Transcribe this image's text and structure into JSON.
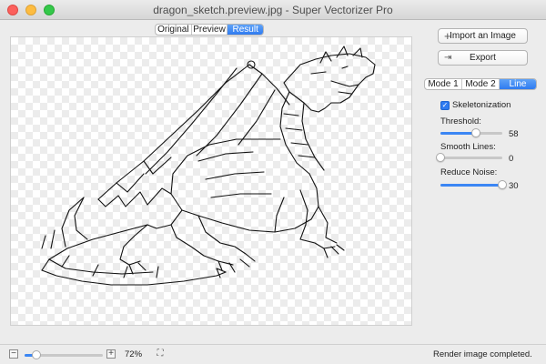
{
  "window": {
    "title": "dragon_sketch.preview.jpg - Super Vectorizer Pro"
  },
  "view_tabs": {
    "items": [
      "Original",
      "Preview",
      "Result"
    ],
    "selected": "Result"
  },
  "sidebar": {
    "import_label": "Import an Image",
    "export_label": "Export",
    "mode_tabs": [
      "Mode 1",
      "Mode 2",
      "Line"
    ],
    "mode_selected": "Line",
    "skeletonization": {
      "label": "Skeletonization",
      "checked": true
    },
    "threshold": {
      "label": "Threshold:",
      "value": "58",
      "fraction": 0.58
    },
    "smooth_lines": {
      "label": "Smooth Lines:",
      "value": "0",
      "fraction": 0.0
    },
    "reduce_noise": {
      "label": "Reduce Noise:",
      "value": "30",
      "fraction": 1.0
    }
  },
  "bottom": {
    "zoom_out": "−",
    "zoom_in": "+",
    "zoom_value": "72%",
    "zoom_fraction": 0.15,
    "status": "Render image completed."
  },
  "icons": {
    "import": "plus-icon",
    "export": "export-icon",
    "fullscreen": "fullscreen-icon",
    "check": "checkmark-icon"
  },
  "colors": {
    "accent": "#2f7bf0",
    "close": "#fc605c",
    "minimize": "#fdbc40",
    "maximize": "#34c84a"
  }
}
